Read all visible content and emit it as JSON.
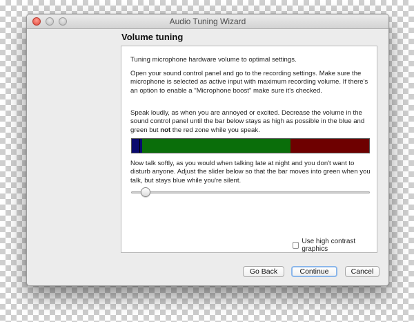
{
  "window": {
    "title": "Audio Tuning Wizard"
  },
  "page": {
    "heading": "Volume tuning",
    "paragraph1": "Tuning microphone hardware volume to optimal settings.",
    "paragraph2": "Open your sound control panel and go to the recording settings. Make sure the microphone is selected as active input with maximum recording volume. If there's an option to enable a \"Microphone boost\" make sure it's checked.",
    "paragraph3_before": "Speak loudly, as when you are annoyed or excited. Decrease the volume in the sound control panel until the bar below stays as high as possible in the blue and green but ",
    "paragraph3_bold": "not",
    "paragraph3_after": " the red zone while you speak.",
    "paragraph4": "Now talk softly, as you would when talking late at night and you don't want to disturb anyone. Adjust the slider below so that the bar moves into green when you talk, but stays blue while you're silent."
  },
  "level_meter": {
    "zones": [
      {
        "name": "blue",
        "color": "#0a0a6e",
        "fraction": 0.045
      },
      {
        "name": "green",
        "color": "#0a6e0a",
        "fraction": 0.625
      },
      {
        "name": "red",
        "color": "#6e0000",
        "fraction": 0.33
      }
    ],
    "current_level_fraction": 0.033
  },
  "slider": {
    "value_fraction": 0.06
  },
  "options": {
    "high_contrast_label": "Use high contrast graphics",
    "high_contrast_checked": false
  },
  "buttons": {
    "back_label": "Go Back",
    "continue_label": "Continue",
    "cancel_label": "Cancel"
  }
}
